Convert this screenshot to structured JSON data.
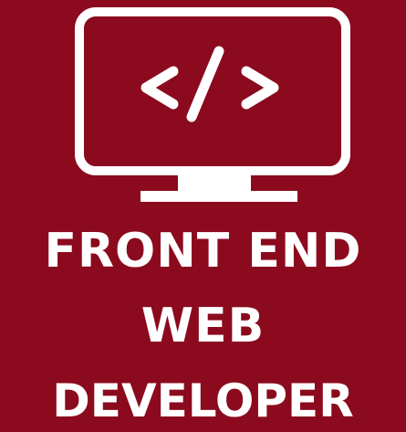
{
  "logo": {
    "icon": "monitor-code-icon",
    "code_symbol": "</>",
    "colors": {
      "background": "#8b0a1e",
      "foreground": "#ffffff"
    }
  },
  "title": {
    "line1": "FRONT END",
    "line2": "WEB",
    "line3": "DEVELOPER"
  }
}
